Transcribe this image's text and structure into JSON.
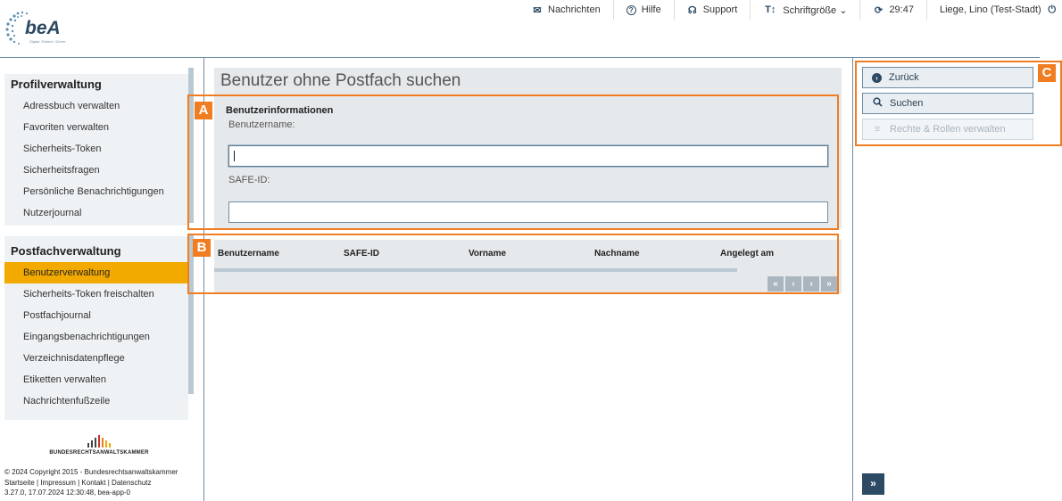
{
  "logo": {
    "name": "beA",
    "tagline": "Digital. Einfach. Sicher."
  },
  "topnav": [
    {
      "icon": "envelope-icon",
      "glyph": "✉",
      "label": "Nachrichten"
    },
    {
      "icon": "help-icon",
      "glyph": "?",
      "label": "Hilfe"
    },
    {
      "icon": "headset-icon",
      "glyph": "☊",
      "label": "Support"
    },
    {
      "icon": "font-size-icon",
      "glyph": "T↕",
      "label": "Schriftgröße ⌄"
    },
    {
      "icon": "refresh-icon",
      "glyph": "⟳",
      "label": "29:47"
    },
    {
      "icon": "power-icon",
      "glyph": "⏻",
      "label": "Liege, Lino (Test-Stadt)"
    }
  ],
  "sidebar": {
    "profil": {
      "title": "Profilverwaltung",
      "items": [
        "Adressbuch verwalten",
        "Favoriten verwalten",
        "Sicherheits-Token",
        "Sicherheitsfragen",
        "Persönliche Benachrichtigungen",
        "Nutzerjournal"
      ]
    },
    "postfach": {
      "title": "Postfachverwaltung",
      "active": "Benutzerverwaltung",
      "items": [
        "Benutzerverwaltung",
        "Sicherheits-Token freischalten",
        "Postfachjournal",
        "Eingangsbenachrichtigungen",
        "Verzeichnisdatenpflege",
        "Etiketten verwalten",
        "Nachrichtenfußzeile"
      ]
    }
  },
  "footer": {
    "org": "BUNDESRECHTSANWALTSKAMMER",
    "copyright": "© 2024 Copyright 2015 - Bundesrechtsanwaltskammer",
    "links": "Startseite | Impressum | Kontakt | Datenschutz",
    "version": "3.27.0, 17.07.2024 12:30:48, bea-app-0"
  },
  "main": {
    "title": "Benutzer ohne Postfach suchen",
    "section_title": "Benutzerinformationen",
    "username_label": "Benutzername:",
    "username_value": "",
    "safeid_label": "SAFE-ID:",
    "safeid_value": "",
    "table_columns": [
      "Benutzername",
      "SAFE-ID",
      "Vorname",
      "Nachname",
      "Angelegt am"
    ],
    "pager": [
      "«",
      "‹",
      "›",
      "»"
    ]
  },
  "actions": {
    "back": "Zurück",
    "search": "Suchen",
    "roles": "Rechte & Rollen verwalten",
    "expand": "»"
  },
  "annotations": [
    "A",
    "B",
    "C"
  ],
  "colors": {
    "accent": "#f2a900",
    "annotation": "#f07d22",
    "primary": "#2c4a63"
  }
}
